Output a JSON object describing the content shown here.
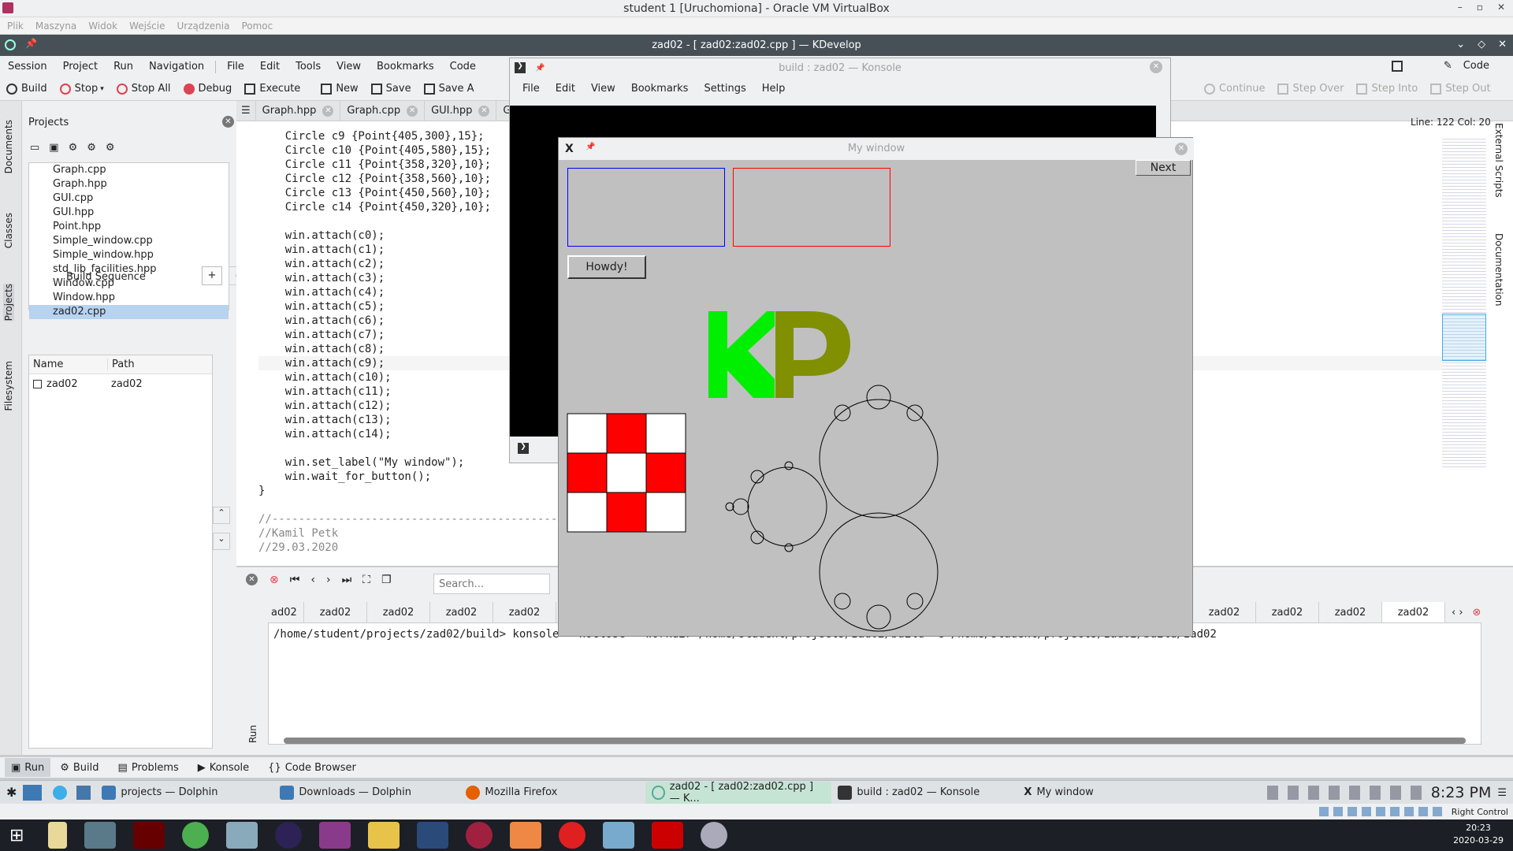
{
  "vbox": {
    "title": "student 1 [Uruchomiona] - Oracle VM VirtualBox",
    "menu": [
      "Plik",
      "Maszyna",
      "Widok",
      "Wejście",
      "Urządzenia",
      "Pomoc"
    ]
  },
  "kdevelop": {
    "title": "zad02 - [ zad02:zad02.cpp ] — KDevelop",
    "menu": [
      "Session",
      "Project",
      "Run",
      "Navigation",
      "File",
      "Edit",
      "Tools",
      "View",
      "Bookmarks",
      "Code"
    ],
    "code_mode": "Code",
    "toolbar": {
      "build": "Build",
      "stop": "Stop",
      "stop_all": "Stop All",
      "debug": "Debug",
      "execute": "Execute",
      "new": "New",
      "save": "Save",
      "save_as": "Save A",
      "continue": "Continue",
      "step_over": "Step Over",
      "step_into": "Step Into",
      "step_out": "Step Out"
    },
    "left_tabs": [
      "Documents",
      "Classes",
      "Projects",
      "Filesystem"
    ],
    "right_tabs": [
      "External Scripts",
      "Documentation"
    ],
    "projects": {
      "title": "Projects",
      "files": [
        "Graph.cpp",
        "Graph.hpp",
        "GUI.cpp",
        "GUI.hpp",
        "Point.hpp",
        "Simple_window.cpp",
        "Simple_window.hpp",
        "std_lib_facilities.hpp",
        "Window.cpp",
        "Window.hpp",
        "zad02.cpp"
      ],
      "build_sequence": "Build Sequence",
      "columns": [
        "Name",
        "Path"
      ],
      "rows": [
        {
          "name": "zad02",
          "path": "zad02"
        }
      ]
    },
    "editor": {
      "tabs": [
        "Graph.hpp",
        "Graph.cpp",
        "GUI.hpp",
        "GU"
      ],
      "line_col": "Line: 122 Col: 20",
      "code": [
        "    Circle c9 {Point{405,300},15};",
        "    Circle c10 {Point{405,580},15};",
        "    Circle c11 {Point{358,320},10};",
        "    Circle c12 {Point{358,560},10};",
        "    Circle c13 {Point{450,560},10};",
        "    Circle c14 {Point{450,320},10};",
        "",
        "    win.attach(c0);",
        "    win.attach(c1);",
        "    win.attach(c2);",
        "    win.attach(c3);",
        "    win.attach(c4);",
        "    win.attach(c5);",
        "    win.attach(c6);",
        "    win.attach(c7);",
        "    win.attach(c8);",
        "    win.attach(c9);",
        "    win.attach(c10);",
        "    win.attach(c11);",
        "    win.attach(c12);",
        "    win.attach(c13);",
        "    win.attach(c14);",
        "",
        "    win.set_label(\"My window\");",
        "    win.wait_for_button();",
        "}",
        "",
        "//-------------------------------------------------------",
        "//Kamil Petk",
        "//29.03.2020"
      ]
    },
    "output": {
      "search_placeholder": "Search...",
      "tabs": [
        "ad02",
        "zad02",
        "zad02",
        "zad02",
        "zad02",
        "zad02",
        "zad02",
        "zad02",
        "zad02"
      ],
      "console_line": "/home/student/projects/zad02/build> konsole --noclose --workdir /home/student/projects/zad02/build -e /home/student/projects/zad02/build/zad02",
      "run_label": "Run"
    },
    "bottom_tabs": [
      "Run",
      "Build",
      "Problems",
      "Konsole",
      "Code Browser"
    ]
  },
  "konsole": {
    "title": "build : zad02 — Konsole",
    "menu": [
      "File",
      "Edit",
      "View",
      "Bookmarks",
      "Settings",
      "Help"
    ]
  },
  "mywindow": {
    "title": "My window",
    "next_button": "Next",
    "howdy_button": "Howdy!",
    "logo": "KP"
  },
  "taskbar": {
    "tasks": [
      "projects — Dolphin",
      "Downloads — Dolphin",
      "Mozilla Firefox",
      "zad02 - [ zad02:zad02.cpp ] — K...",
      "build : zad02 — Konsole",
      "My window"
    ],
    "clock": "8:23 PM",
    "right_control": "Right Control"
  },
  "win_taskbar": {
    "time": "20:23",
    "date": "2020-03-29"
  },
  "colors": {
    "kd_title": "#475057",
    "red": "#ff0000",
    "green": "#00ee00",
    "olive": "#809000"
  }
}
